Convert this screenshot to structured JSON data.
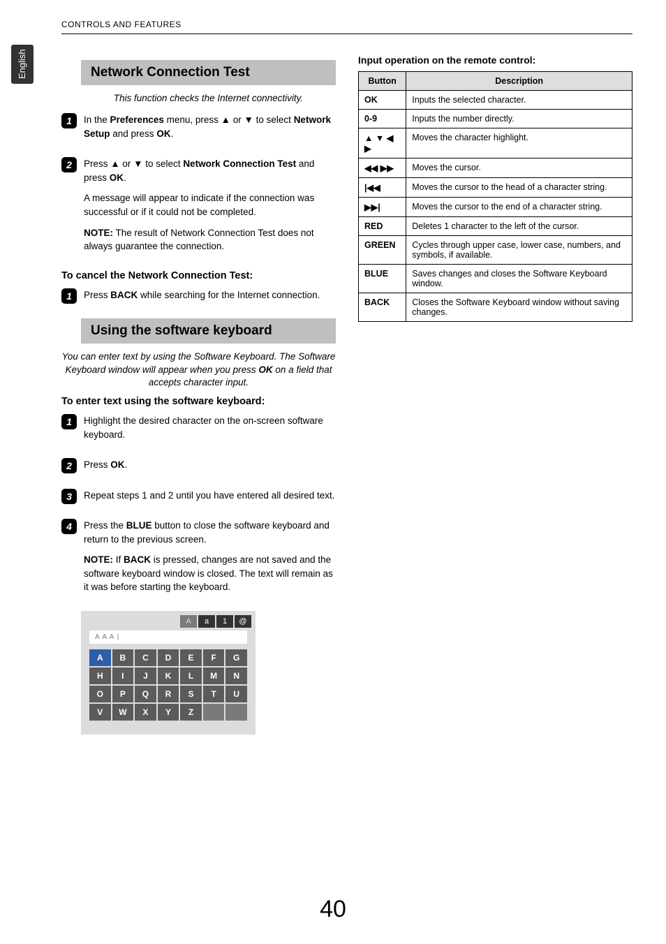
{
  "language_tab": "English",
  "header": "CONTROLS AND FEATURES",
  "left": {
    "network": {
      "title": "Network Connection Test",
      "intro": "This function checks the Internet connectivity.",
      "step1_a": "In the ",
      "step1_b": "Preferences",
      "step1_c": " menu, press ",
      "glyph_up": "▲",
      "step1_d": " or ",
      "glyph_down": "▼",
      "step1_e": " to select ",
      "step1_f": "Network Setup",
      "step1_g": " and press ",
      "step1_h": "OK",
      "step1_i": ".",
      "step2_a": "Press ",
      "step2_b": " to select ",
      "step2_c": "Network Connection Test",
      "step2_d": " and press ",
      "step2_note1": "A message will appear to indicate if the connection was successful or if it could not be completed.",
      "step2_note2a": "NOTE:",
      "step2_note2b": " The result of Network Connection Test does not always guarantee the connection.",
      "cancel_head": "To cancel the Network Connection Test:",
      "cancel_a": "Press ",
      "cancel_b": "BACK",
      "cancel_c": " while searching for the Internet connection."
    },
    "soft": {
      "title": "Using the software keyboard",
      "intro_a": "You can enter text by using the Software Keyboard. The Software Keyboard window will appear when you press ",
      "intro_b": "OK",
      "intro_c": " on a field that accepts character input.",
      "enter_head": "To enter text using the software keyboard:",
      "s1": "Highlight the desired character on the on-screen software keyboard.",
      "s2_a": "Press ",
      "s2_b": "OK",
      "s2_c": ".",
      "s3": "Repeat steps 1 and 2 until you have entered all desired text.",
      "s4_a": "Press the ",
      "s4_b": "BLUE",
      "s4_c": " button to close the software keyboard and return to the previous screen.",
      "s4_note_a": "NOTE:",
      "s4_note_b": " If ",
      "s4_note_c": "BACK",
      "s4_note_d": " is pressed, changes are not saved and the software keyboard window is closed. The text will remain as it was before starting the keyboard."
    },
    "keyboard": {
      "chips": [
        "A",
        "a",
        "1",
        "@"
      ],
      "field": "A A A |",
      "keys": [
        "A",
        "B",
        "C",
        "D",
        "E",
        "F",
        "G",
        "H",
        "I",
        "J",
        "K",
        "L",
        "M",
        "N",
        "O",
        "P",
        "Q",
        "R",
        "S",
        "T",
        "U",
        "V",
        "W",
        "X",
        "Y",
        "Z",
        "",
        ""
      ]
    }
  },
  "right": {
    "subhead": "Input operation on the remote control:",
    "th_button": "Button",
    "th_desc": "Description",
    "rows": [
      {
        "btn": "OK",
        "desc": "Inputs the selected character."
      },
      {
        "btn": "0-9",
        "desc": "Inputs the number directly."
      },
      {
        "btn": "▲ ▼ ◀ ▶",
        "desc": "Moves the character highlight."
      },
      {
        "btn": "◀◀ ▶▶",
        "desc": "Moves the cursor."
      },
      {
        "btn": "|◀◀",
        "desc": "Moves the cursor to the head of a character string."
      },
      {
        "btn": "▶▶|",
        "desc": "Moves the cursor to the end of a character string."
      },
      {
        "btn": "RED",
        "desc": "Deletes 1 character to the left of the cursor."
      },
      {
        "btn": "GREEN",
        "desc": "Cycles through upper case, lower case, numbers, and symbols, if available."
      },
      {
        "btn": "BLUE",
        "desc": "Saves changes and closes the Software Keyboard window."
      },
      {
        "btn": "BACK",
        "desc": "Closes the Software Keyboard window without saving changes."
      }
    ]
  },
  "page_number": "40"
}
